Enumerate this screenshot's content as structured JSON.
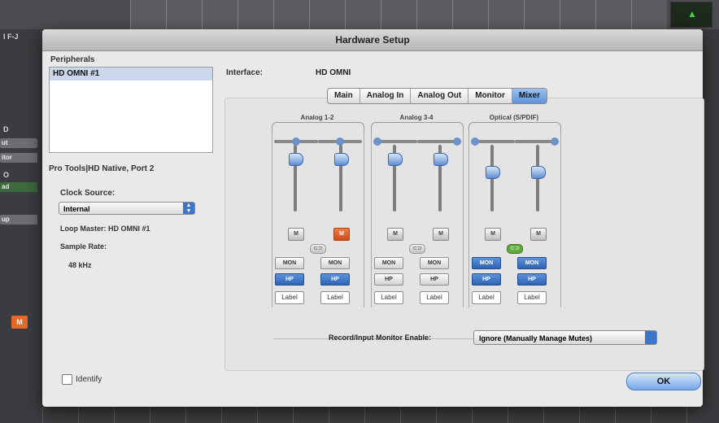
{
  "background": {
    "transport_label": "▲",
    "left_labels": [
      "I F-J",
      "D",
      "ut",
      "itor",
      "O",
      "ad",
      "up"
    ],
    "mute_label": "M"
  },
  "dialog": {
    "title": "Hardware Setup"
  },
  "peripherals": {
    "label": "Peripherals",
    "items": [
      "HD OMNI #1"
    ]
  },
  "port": "Pro Tools|HD Native, Port 2",
  "clock": {
    "label": "Clock Source:",
    "value": "Internal",
    "loop_master": "Loop Master: HD OMNI #1"
  },
  "sample_rate": {
    "label": "Sample Rate:",
    "value": "48 kHz"
  },
  "identify": "Identify",
  "interface": {
    "label": "Interface:",
    "value": "HD OMNI"
  },
  "tabs": [
    "Main",
    "Analog In",
    "Analog Out",
    "Monitor",
    "Mixer"
  ],
  "active_tab": "Mixer",
  "mixer": {
    "groups": [
      {
        "name": "Analog 1-2",
        "mute_left": "M",
        "mute_right": "M",
        "mute_right_on": true,
        "mon": [
          "MON",
          "MON"
        ],
        "hp": [
          "HP",
          "HP"
        ],
        "labels": [
          "Label",
          "Label"
        ],
        "mon_active": false,
        "link_on": false
      },
      {
        "name": "Analog 3-4",
        "mute_left": "M",
        "mute_right": "M",
        "mute_right_on": false,
        "mon": [
          "MON",
          "MON"
        ],
        "hp": [
          "HP",
          "HP"
        ],
        "labels": [
          "Label",
          "Label"
        ],
        "mon_active": false,
        "link_on": false
      },
      {
        "name": "Optical (S/PDIF)",
        "mute_left": "M",
        "mute_right": "M",
        "mute_right_on": false,
        "mon": [
          "MON",
          "MON"
        ],
        "hp": [
          "HP",
          "HP"
        ],
        "labels": [
          "Label",
          "Label"
        ],
        "mon_active": true,
        "link_on": true
      }
    ]
  },
  "record_monitor": {
    "label": "Record/Input Monitor Enable:",
    "value": "Ignore (Manually Manage Mutes)"
  },
  "ok_button": "OK"
}
